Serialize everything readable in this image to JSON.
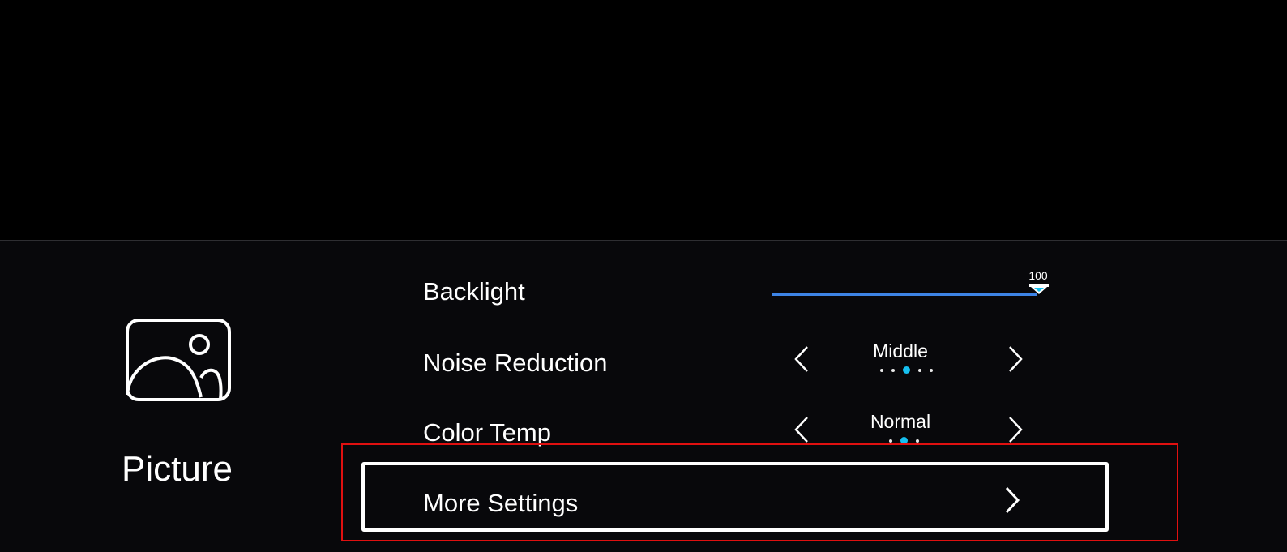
{
  "category": {
    "title": "Picture",
    "icon": "picture-icon"
  },
  "settings": {
    "backlight": {
      "label": "Backlight",
      "value": "100",
      "level": 100,
      "accent_color": "#3d84e6"
    },
    "noise_reduction": {
      "label": "Noise Reduction",
      "value": "Middle",
      "options_count": 5,
      "selected_index": 2
    },
    "color_temp": {
      "label": "Color Temp",
      "value": "Normal",
      "options_count": 3,
      "selected_index": 1
    },
    "more_settings": {
      "label": "More Settings",
      "focused": true
    }
  },
  "colors": {
    "accent": "#16c0f0",
    "slider": "#3d84e6",
    "highlight_outline": "#e01010",
    "background": "#08080b"
  }
}
